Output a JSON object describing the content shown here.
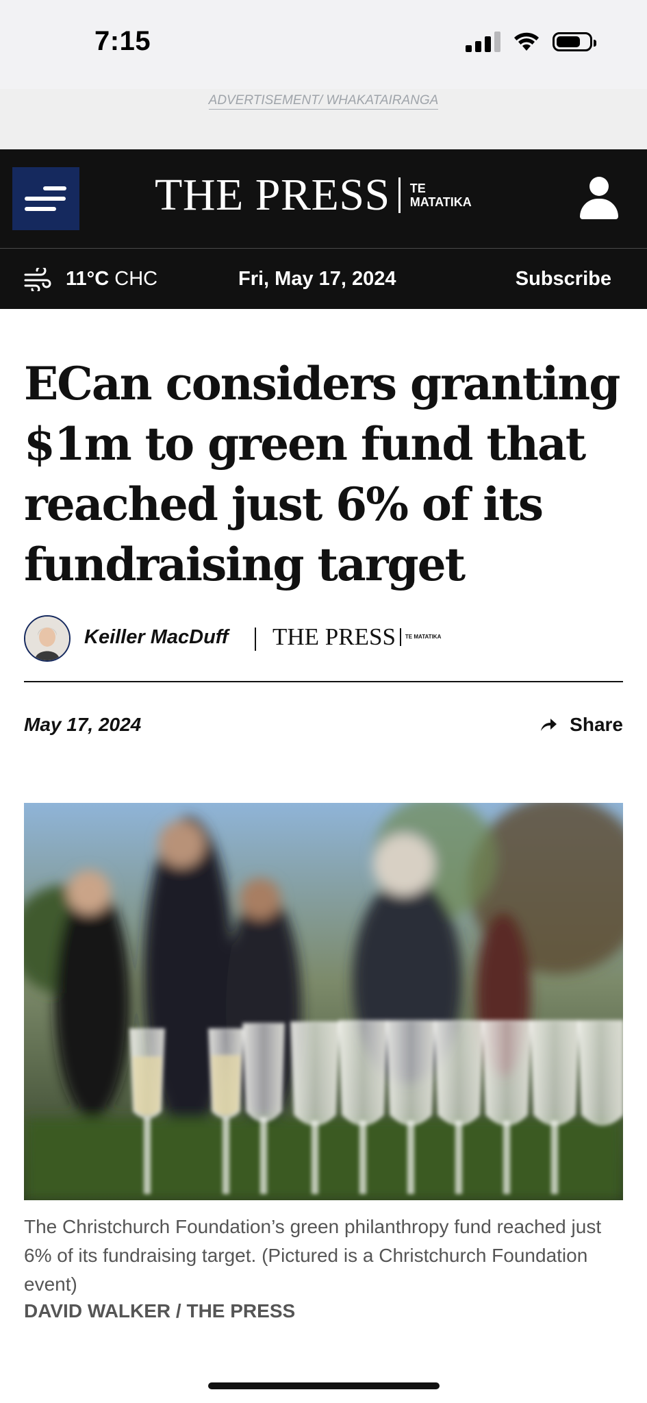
{
  "status_bar": {
    "time": "7:15"
  },
  "ad": {
    "label": "ADVERTISEMENT/ WHAKATAIRANGA"
  },
  "header": {
    "logo_main": "THE PRESS",
    "logo_sub": "TE MATATIKA"
  },
  "subbar": {
    "temperature": "11°C",
    "city": "CHC",
    "date": "Fri, May 17, 2024",
    "subscribe_label": "Subscribe"
  },
  "article": {
    "headline": "ECan considers granting $1m to green fund that reached just 6% of its fundraising target",
    "author": "Keiller MacDuff",
    "publication_logo_main": "THE PRESS",
    "publication_logo_sub": "TE MATATIKA",
    "date": "May 17, 2024",
    "share_label": "Share",
    "image_caption": "The Christchurch Foundation’s green philanthropy fund reached just 6% of its fundraising target. (Pictured is a Christchurch Foundation event)",
    "image_credit": "DAVID WALKER / THE PRESS"
  },
  "colors": {
    "header_bg": "#111111",
    "menu_button_bg": "#15295e",
    "caption_text": "#555555"
  },
  "icons": {
    "menu": "hamburger-menu-icon",
    "account": "user-icon",
    "weather": "wind-icon",
    "share": "share-arrow-icon"
  }
}
